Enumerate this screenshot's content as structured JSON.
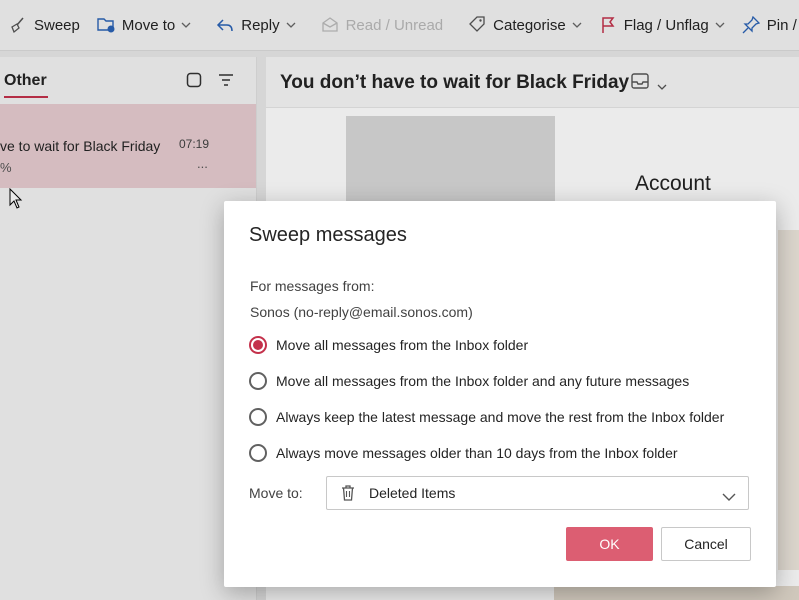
{
  "toolbar": {
    "sweep": "Sweep",
    "move_to": "Move to",
    "reply": "Reply",
    "read_unread": "Read / Unread",
    "categorise": "Categorise",
    "flag_unflag": "Flag / Unflag",
    "pin": "Pin /"
  },
  "message_list": {
    "tab_other": "Other",
    "item": {
      "subject": "ve to wait for Black Friday",
      "time": "07:19",
      "preview": "%",
      "more": "..."
    }
  },
  "reading_pane": {
    "title": "You don’t have to wait for Black Friday",
    "body_text": "Account"
  },
  "dialog": {
    "title": "Sweep messages",
    "from_label": "For messages from:",
    "sender": "Sonos (no-reply@email.sonos.com)",
    "options": [
      {
        "label": "Move all messages from the Inbox folder",
        "selected": true
      },
      {
        "label": "Move all messages from the Inbox folder and any future messages",
        "selected": false
      },
      {
        "label": "Always keep the latest message and move the rest from the Inbox folder",
        "selected": false
      },
      {
        "label": "Always move messages older than 10 days from the Inbox folder",
        "selected": false
      }
    ],
    "move_to_label": "Move to:",
    "move_to_value": "Deleted Items",
    "ok_label": "OK",
    "cancel_label": "Cancel"
  },
  "colors": {
    "accent": "#c4314b",
    "ok_button": "#dc5e72",
    "selected_item": "#e8cdd1"
  }
}
